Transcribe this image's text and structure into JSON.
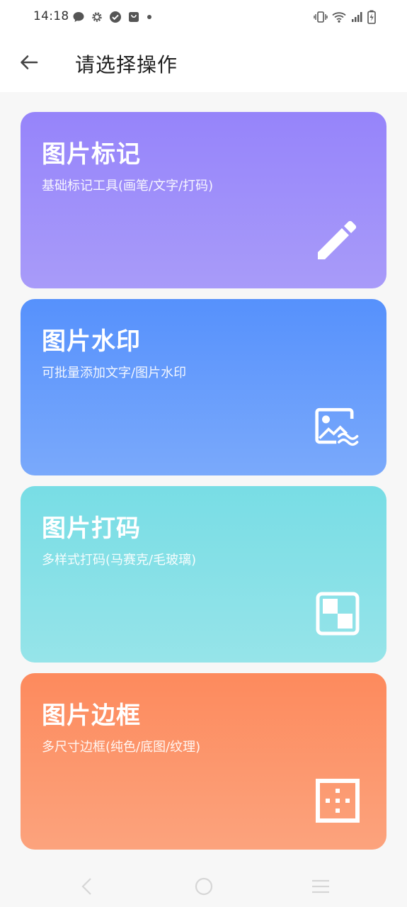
{
  "status_bar": {
    "time": "14:18",
    "left_icons": [
      "chat-bubble-icon",
      "gear-icon",
      "check-circle-icon",
      "shopping-bag-icon",
      "dot-icon"
    ],
    "right_icons": [
      "vibrate-icon",
      "wifi-icon",
      "signal-icon",
      "battery-charging-icon"
    ]
  },
  "app_bar": {
    "back_icon": "arrow-left-icon",
    "title": "请选择操作"
  },
  "cards": [
    {
      "title": "图片标记",
      "desc": "基础标记工具(画笔/文字/打码)",
      "icon": "pencil-icon",
      "color": "#9684fa"
    },
    {
      "title": "图片水印",
      "desc": "可批量添加文字/图片水印",
      "icon": "image-wave-icon",
      "color": "#5691fc"
    },
    {
      "title": "图片打码",
      "desc": "多样式打码(马赛克/毛玻璃)",
      "icon": "checker-square-icon",
      "color": "#78dde5"
    },
    {
      "title": "图片边框",
      "desc": "多尺寸边框(纯色/底图/纹理)",
      "icon": "dotted-frame-icon",
      "color": "#fd8a5d"
    }
  ],
  "nav_bar": {
    "icons": [
      "nav-back-icon",
      "nav-home-icon",
      "nav-menu-icon"
    ]
  }
}
